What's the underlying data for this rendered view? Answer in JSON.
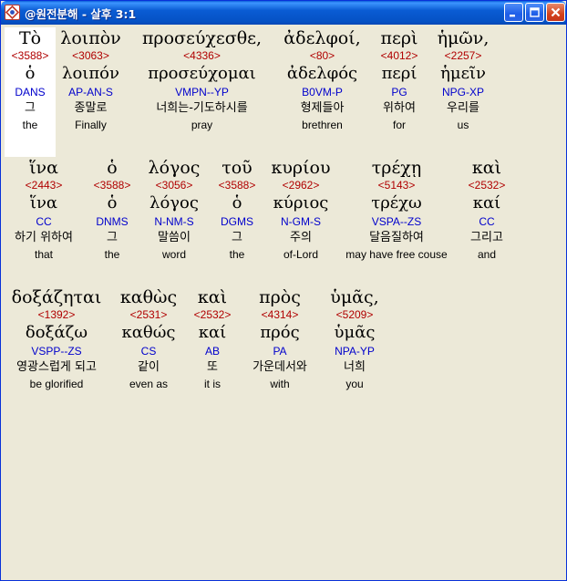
{
  "window": {
    "title": "@원전분해 - 살후 3:1"
  },
  "rows": [
    [
      {
        "greek": "Τὸ",
        "strong": "<3588>",
        "lemma": "ὁ",
        "parse": "DANS",
        "korean": "그",
        "english": "the",
        "selected": true
      },
      {
        "greek": "λοιπὸν",
        "strong": "<3063>",
        "lemma": "λοιπόν",
        "parse": "AP-AN-S",
        "korean": "종말로",
        "english": "Finally"
      },
      {
        "greek": "προσεύχεσθε,",
        "strong": "<4336>",
        "lemma": "προσεύχομαι",
        "parse": "VMPN--YP",
        "korean": "너희는-기도하시를",
        "english": "pray"
      },
      {
        "greek": "ἀδελφοί,",
        "strong": "<80>",
        "lemma": "ἀδελφός",
        "parse": "B0VM-P",
        "korean": "형제들아",
        "english": "brethren"
      },
      {
        "greek": "περὶ",
        "strong": "<4012>",
        "lemma": "περί",
        "parse": "PG",
        "korean": "위하여",
        "english": "for"
      },
      {
        "greek": "ἡμῶν,",
        "strong": "<2257>",
        "lemma": "ἡμεῖν",
        "parse": "NPG-XP",
        "korean": "우리를",
        "english": "us"
      }
    ],
    [
      {
        "greek": "ἵνα",
        "strong": "<2443>",
        "lemma": "ἵνα",
        "parse": "CC",
        "korean": "하기 위하여",
        "english": "that"
      },
      {
        "greek": "ὁ",
        "strong": "<3588>",
        "lemma": "ὁ",
        "parse": "DNMS",
        "korean": "그",
        "english": "the"
      },
      {
        "greek": "λόγος",
        "strong": "<3056>",
        "lemma": "λόγος",
        "parse": "N-NM-S",
        "korean": "말씀이",
        "english": "word"
      },
      {
        "greek": "τοῦ",
        "strong": "<3588>",
        "lemma": "ὁ",
        "parse": "DGMS",
        "korean": "그",
        "english": "the"
      },
      {
        "greek": "κυρίου",
        "strong": "<2962>",
        "lemma": "κύριος",
        "parse": "N-GM-S",
        "korean": "주의",
        "english": "of-Lord"
      },
      {
        "greek": "τρέχῃ",
        "strong": "<5143>",
        "lemma": "τρέχω",
        "parse": "VSPA--ZS",
        "korean": "달음질하여",
        "english": "may have free couse"
      },
      {
        "greek": "καὶ",
        "strong": "<2532>",
        "lemma": "καί",
        "parse": "CC",
        "korean": "그리고",
        "english": "and"
      }
    ],
    [
      {
        "greek": "δοξάζηται",
        "strong": "<1392>",
        "lemma": "δοξάζω",
        "parse": "VSPP--ZS",
        "korean": "영광스럽게 되고",
        "english": "be glorified"
      },
      {
        "greek": "καθὼς",
        "strong": "<2531>",
        "lemma": "καθώς",
        "parse": "CS",
        "korean": "같이",
        "english": "even as"
      },
      {
        "greek": "καὶ",
        "strong": "<2532>",
        "lemma": "καί",
        "parse": "AB",
        "korean": "또",
        "english": "it is"
      },
      {
        "greek": "πρὸς",
        "strong": "<4314>",
        "lemma": "πρός",
        "parse": "PA",
        "korean": "가운데서와",
        "english": "with"
      },
      {
        "greek": "ὑμᾶς,",
        "strong": "<5209>",
        "lemma": "ὑμᾶς",
        "parse": "NPA-YP",
        "korean": "너희",
        "english": "you"
      }
    ]
  ]
}
